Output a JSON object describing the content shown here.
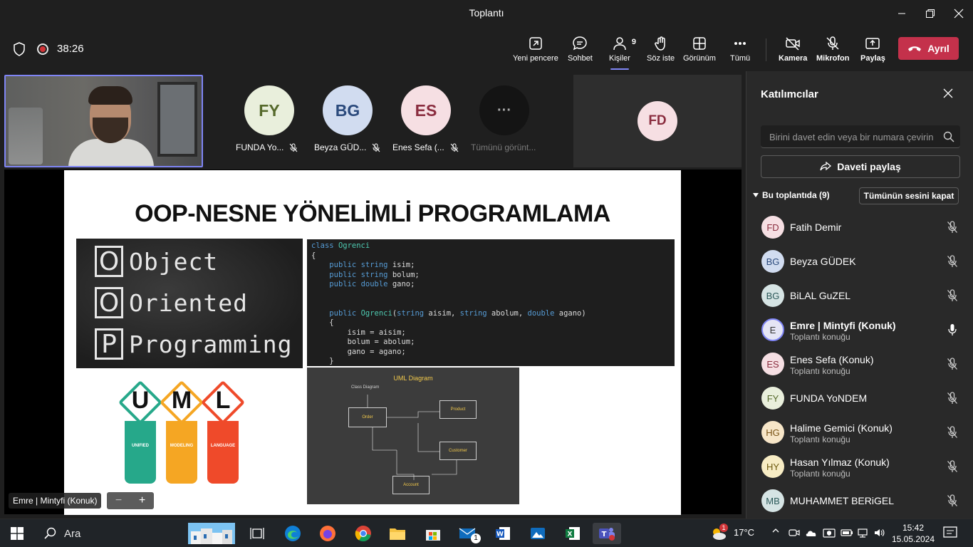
{
  "window": {
    "title": "Toplantı"
  },
  "toolbar": {
    "timer": "38:26",
    "new_window": "Yeni pencere",
    "chat": "Sohbet",
    "people": "Kişiler",
    "people_count": "9",
    "raise_hand": "Söz iste",
    "view": "Görünüm",
    "more": "Tümü",
    "camera": "Kamera",
    "mic": "Mikrofon",
    "share": "Paylaş",
    "leave": "Ayrıl"
  },
  "stage": {
    "participants": [
      {
        "initials": "FY",
        "name": "FUNDA Yo...",
        "bg": "#e9efdc",
        "fg": "#55692b"
      },
      {
        "initials": "BG",
        "name": "Beyza GÜD...",
        "bg": "#d1dcf0",
        "fg": "#2b4a7c"
      },
      {
        "initials": "ES",
        "name": "Enes Sefa (...",
        "bg": "#f6dfe3",
        "fg": "#8a2d3f"
      }
    ],
    "view_all": "Tümünü görünt...",
    "fd_initials": "FD",
    "nameplate": "Emre | Mintyfi (Konuk)"
  },
  "slide": {
    "title": "OOP-NESNE YÖNELİMLİ PROGRAMLAMA",
    "chalk": [
      {
        "letter": "O",
        "word": "Object"
      },
      {
        "letter": "O",
        "word": "Oriented"
      },
      {
        "letter": "P",
        "word": "Programming"
      }
    ],
    "code": {
      "class_kw": "class",
      "class_name": "Ogrenci",
      "lines": [
        "{",
        "    public string isim;",
        "    public string bolum;",
        "    public double gano;",
        "",
        "",
        "    public Ogrenci(string aisim, string abolum, double agano)",
        "    {",
        "        isim = aisim;",
        "        bolum = abolum;",
        "        gano = agano;",
        "    }"
      ]
    },
    "uml_logo": [
      {
        "letter": "U",
        "label": "UNIFIED",
        "color": "#26a88a"
      },
      {
        "letter": "M",
        "label": "MODELING",
        "color": "#f5a623"
      },
      {
        "letter": "L",
        "label": "LANGUAGE",
        "color": "#ef4a2a"
      }
    ],
    "uml_diagram": {
      "title": "UML Diagram",
      "subtitle": "Class Diagram",
      "boxes": [
        "Order",
        "Product",
        "Customer",
        "Account"
      ]
    }
  },
  "panel": {
    "title": "Katılımcılar",
    "invite_placeholder": "Birini davet edin veya bir numara çevirin",
    "share_invite": "Daveti paylaş",
    "section": "Bu toplantıda (9)",
    "mute_all": "Tümünün sesini kapat",
    "people": [
      {
        "initials": "FD",
        "name": "Fatih Demir",
        "sub": "",
        "bg": "#f6dfe3",
        "fg": "#8a2d3f"
      },
      {
        "initials": "BG",
        "name": "Beyza GÜDEK",
        "sub": "",
        "bg": "#d1dcf0",
        "fg": "#2b4a7c"
      },
      {
        "initials": "BG",
        "name": "BiLAL GuZEL",
        "sub": "",
        "bg": "#d6e4e4",
        "fg": "#2d5a5a"
      },
      {
        "initials": "E",
        "name": "Emre | Mintyfi (Konuk)",
        "sub": "Toplantı konuğu",
        "bg": "#e5e5f5",
        "fg": "#333333"
      },
      {
        "initials": "ES",
        "name": "Enes Sefa (Konuk)",
        "sub": "Toplantı konuğu",
        "bg": "#f6dfe3",
        "fg": "#8a2d3f"
      },
      {
        "initials": "FY",
        "name": "FUNDA YoNDEM",
        "sub": "",
        "bg": "#e9efdc",
        "fg": "#55692b"
      },
      {
        "initials": "HG",
        "name": "Halime Gemici (Konuk)",
        "sub": "Toplantı konuğu",
        "bg": "#f7e6c8",
        "fg": "#7a5416"
      },
      {
        "initials": "HY",
        "name": "Hasan Yılmaz (Konuk)",
        "sub": "Toplantı konuğu",
        "bg": "#f7ecc4",
        "fg": "#6d5a10"
      },
      {
        "initials": "MB",
        "name": "MUHAMMET BERiGEL",
        "sub": "",
        "bg": "#d6e4e4",
        "fg": "#2d5a5a"
      }
    ]
  },
  "taskbar": {
    "search": "Ara",
    "weather": "17°C",
    "weather_badge": "1",
    "mail_badge": "1",
    "time": "15:42",
    "date": "15.05.2024"
  }
}
